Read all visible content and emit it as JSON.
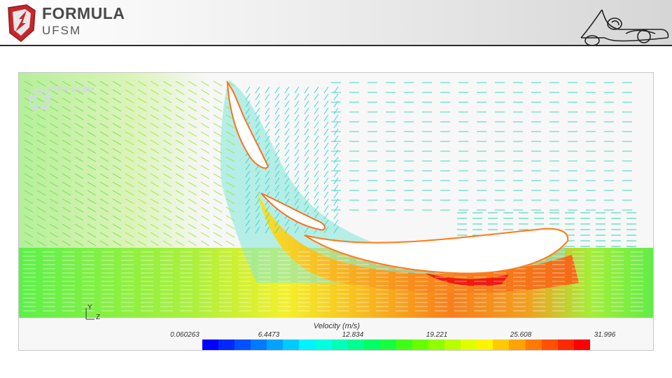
{
  "header": {
    "brand_name": "FORMULA",
    "brand_sub": "UFSM",
    "logo_icon": "shield-lightning-icon",
    "car_icon": "race-car-outline-icon"
  },
  "simulation": {
    "watermark_text": "STAR-CCM+",
    "axis_y": "Y",
    "axis_z": "Z",
    "legend": {
      "title": "Velocity (m/s)",
      "ticks": [
        "0.060263",
        "6.4473",
        "12.834",
        "19.221",
        "25.608",
        "31.996"
      ],
      "min": 0.060263,
      "max": 31.996
    }
  },
  "colors": {
    "header_rule": "#2b2b2b",
    "logo_red": "#c8262b",
    "brand_text": "#4a4a4a",
    "colormap": [
      "#0000ff",
      "#0055ff",
      "#00aaff",
      "#00ffff",
      "#00ffaa",
      "#00ff55",
      "#55ff00",
      "#aaff00",
      "#ffff00",
      "#ffaa00",
      "#ff5500",
      "#ff0000"
    ]
  }
}
